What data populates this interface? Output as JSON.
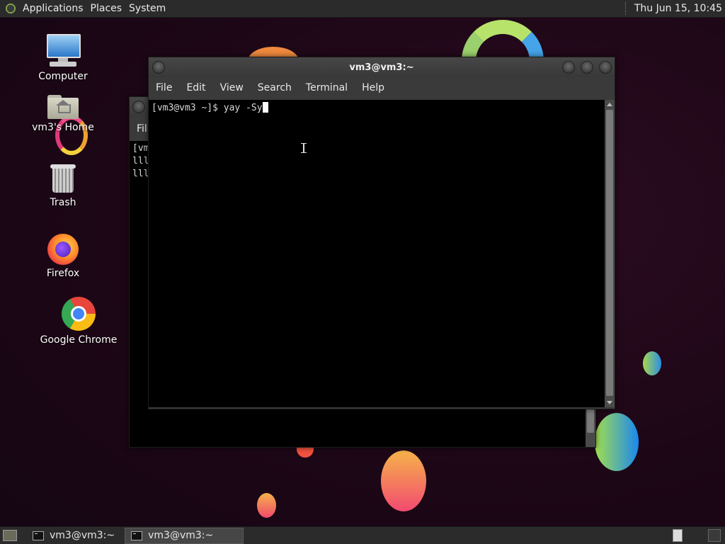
{
  "top_panel": {
    "menus": [
      "Applications",
      "Places",
      "System"
    ],
    "clock": "Thu Jun 15, 10:45"
  },
  "desktop_icons": [
    {
      "label": "Computer"
    },
    {
      "label": "vm3's Home"
    },
    {
      "label": "Trash"
    },
    {
      "label": "Firefox"
    },
    {
      "label": "Google Chrome"
    }
  ],
  "back_window": {
    "menu_partial": "Fil",
    "lines": [
      "[vm",
      "lll",
      "lll"
    ]
  },
  "front_window": {
    "title": "vm3@vm3:~",
    "menus": [
      "File",
      "Edit",
      "View",
      "Search",
      "Terminal",
      "Help"
    ],
    "prompt": "[vm3@vm3 ~]$ yay -Sy"
  },
  "taskbar": {
    "tasks": [
      {
        "label": "vm3@vm3:~",
        "active": false
      },
      {
        "label": "vm3@vm3:~",
        "active": true
      }
    ]
  },
  "colors": {
    "desktop_bg": "#1d0716",
    "panel_bg": "#2b2b2b",
    "terminal_bg": "#000000"
  }
}
